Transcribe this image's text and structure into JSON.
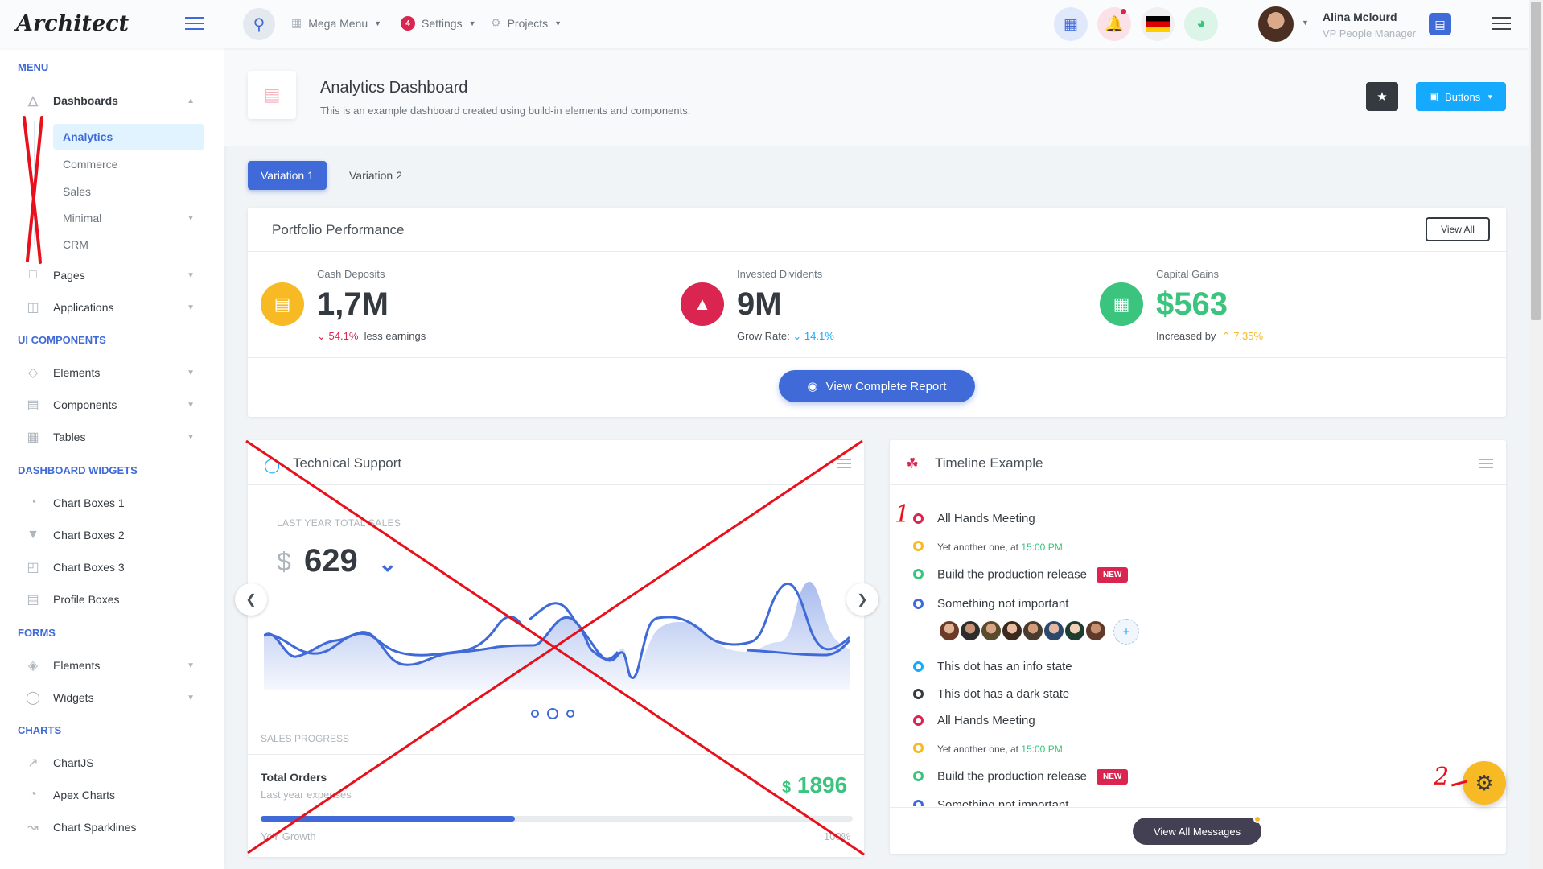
{
  "app": {
    "logo": "Architect"
  },
  "topbar": {
    "mega_menu": "Mega Menu",
    "settings": "Settings",
    "settings_badge": "4",
    "projects": "Projects",
    "user_name": "Alina Mclourd",
    "user_role": "VP People Manager"
  },
  "sidebar": {
    "sections": {
      "menu": "Menu",
      "ui_components": "UI Components",
      "dashboard_widgets": "Dashboard Widgets",
      "forms": "Forms",
      "charts": "Charts"
    },
    "dashboards": "Dashboards",
    "dashboard_subs": [
      "Analytics",
      "Commerce",
      "Sales",
      "Minimal",
      "CRM"
    ],
    "pages": "Pages",
    "applications": "Applications",
    "elements": "Elements",
    "components": "Components",
    "tables": "Tables",
    "widgets": [
      "Chart Boxes 1",
      "Chart Boxes 2",
      "Chart Boxes 3",
      "Profile Boxes"
    ],
    "form_elements": "Elements",
    "form_widgets": "Widgets",
    "charts": [
      "ChartJS",
      "Apex Charts",
      "Chart Sparklines"
    ]
  },
  "page_header": {
    "title": "Analytics Dashboard",
    "subtitle": "This is an example dashboard created using build-in elements and components.",
    "buttons_label": "Buttons"
  },
  "tabs": [
    "Variation 1",
    "Variation 2"
  ],
  "portfolio": {
    "title": "Portfolio Performance",
    "view_all": "View All",
    "stats": [
      {
        "label": "Cash Deposits",
        "value": "1,7M",
        "delta": "54.1%",
        "note": "less earnings"
      },
      {
        "label": "Invested Dividents",
        "value": "9M",
        "note": "Grow Rate:",
        "delta": "14.1%"
      },
      {
        "label": "Capital Gains",
        "value": "$563",
        "note": "Increased by",
        "delta": "7.35%"
      }
    ],
    "report_button": "View Complete Report"
  },
  "support": {
    "title": "Technical Support",
    "sales_label": "LAST YEAR TOTAL SALES",
    "currency": "$",
    "total": "629",
    "progress_label": "SALES PROGRESS",
    "orders_title": "Total Orders",
    "orders_sub": "Last year expenses",
    "orders_value": "1896",
    "growth_label": "YoY Growth",
    "growth_pct": "100%",
    "progress": 0.43
  },
  "timeline": {
    "title": "Timeline Example",
    "items": [
      {
        "text": "All Hands Meeting",
        "color": "#d92550"
      },
      {
        "text": "Yet another one, at",
        "time": "15:00 PM",
        "color": "#f7b924"
      },
      {
        "text": "Build the production release",
        "badge": "NEW",
        "color": "#3ac47d"
      },
      {
        "text": "Something not important",
        "color": "#3f6ad8"
      },
      {
        "text": "This dot has an info state",
        "color": "#16aaff"
      },
      {
        "text": "This dot has a dark state",
        "color": "#343a40"
      },
      {
        "text": "All Hands Meeting",
        "color": "#d92550"
      },
      {
        "text": "Yet another one, at",
        "time": "15:00 PM",
        "color": "#f7b924"
      },
      {
        "text": "Build the production release",
        "badge": "NEW",
        "color": "#3ac47d"
      },
      {
        "text": "Something not important",
        "color": "#3f6ad8"
      }
    ],
    "view_all_messages": "View All Messages"
  },
  "annotations": {
    "mark_1": "1",
    "mark_2": "2"
  },
  "colors": {
    "primary": "#3f6ad8",
    "danger": "#d92550",
    "warning": "#f7b924",
    "success": "#3ac47d",
    "info": "#16aaff",
    "annotation": "#e8101a"
  }
}
